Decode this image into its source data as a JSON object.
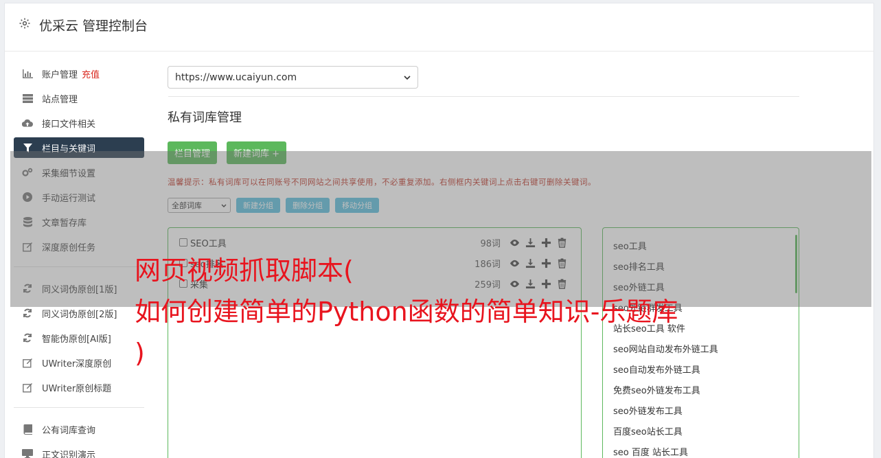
{
  "app": {
    "title": "优采云 管理控制台",
    "icon": "gear-icon"
  },
  "sidebar": {
    "items": [
      {
        "label": "账户管理",
        "badge": "充值",
        "icon": "bar-chart-icon"
      },
      {
        "label": "站点管理",
        "icon": "server-icon"
      },
      {
        "label": "接口文件相关",
        "icon": "cloud-upload-icon"
      },
      {
        "label": "栏目与关键词",
        "icon": "filter-icon",
        "active": true
      },
      {
        "label": "采集细节设置",
        "icon": "gears-icon"
      },
      {
        "label": "手动运行测试",
        "icon": "play-circle-icon"
      },
      {
        "label": "文章暂存库",
        "icon": "database-icon"
      },
      {
        "label": "深度原创任务",
        "icon": "edit-icon"
      },
      {
        "label": "同义词伪原创[1版]",
        "icon": "refresh-icon"
      },
      {
        "label": "同义词伪原创[2版]",
        "icon": "refresh-icon"
      },
      {
        "label": "智能伪原创[AI版]",
        "icon": "refresh-icon"
      },
      {
        "label": "UWriter深度原创",
        "icon": "edit-icon"
      },
      {
        "label": "UWriter原创标题",
        "icon": "edit-icon"
      },
      {
        "label": "公有词库查询",
        "icon": "book-icon"
      },
      {
        "label": "正文识别演示",
        "icon": "monitor-icon"
      }
    ]
  },
  "main": {
    "site_select": "https://www.ucaiyun.com",
    "section_title": "私有词库管理",
    "buttons": {
      "column_manage": "栏目管理",
      "new_library": "新建词库 +"
    },
    "tip": "温馨提示：私有词库可以在同账号不同网站之间共享使用，不必重复添加。右侧框内关键词上点击右键可删除关键词。",
    "filter_select": "全部词库",
    "group_buttons": {
      "new_group": "新建分组",
      "delete_group": "删除分组",
      "move_group": "移动分组"
    },
    "libraries": [
      {
        "name": "SEO工具",
        "count": "98词"
      },
      {
        "name": "seo排名",
        "count": "186词"
      },
      {
        "name": "采集",
        "count": "259词"
      }
    ],
    "keywords": [
      "seo工具",
      "seo排名工具",
      "seo外链工具",
      "seo外链群发工具",
      "站长seo工具 软件",
      "seo网站自动发布外链工具",
      "seo自动发布外链工具",
      "免费seo外链发布工具",
      "seo外链发布工具",
      "百度seo站长工具",
      "seo 百度 站长工具"
    ]
  },
  "overlay_banner": {
    "line1": "网页视频抓取脚本(",
    "line2": "如何创建简单的Python函数的简单知识-乐题库",
    "line3": ")"
  },
  "colors": {
    "active_nav": "#2c3e50",
    "green": "#5cb85c",
    "blue": "#5bc0de",
    "red": "#e8141e"
  }
}
